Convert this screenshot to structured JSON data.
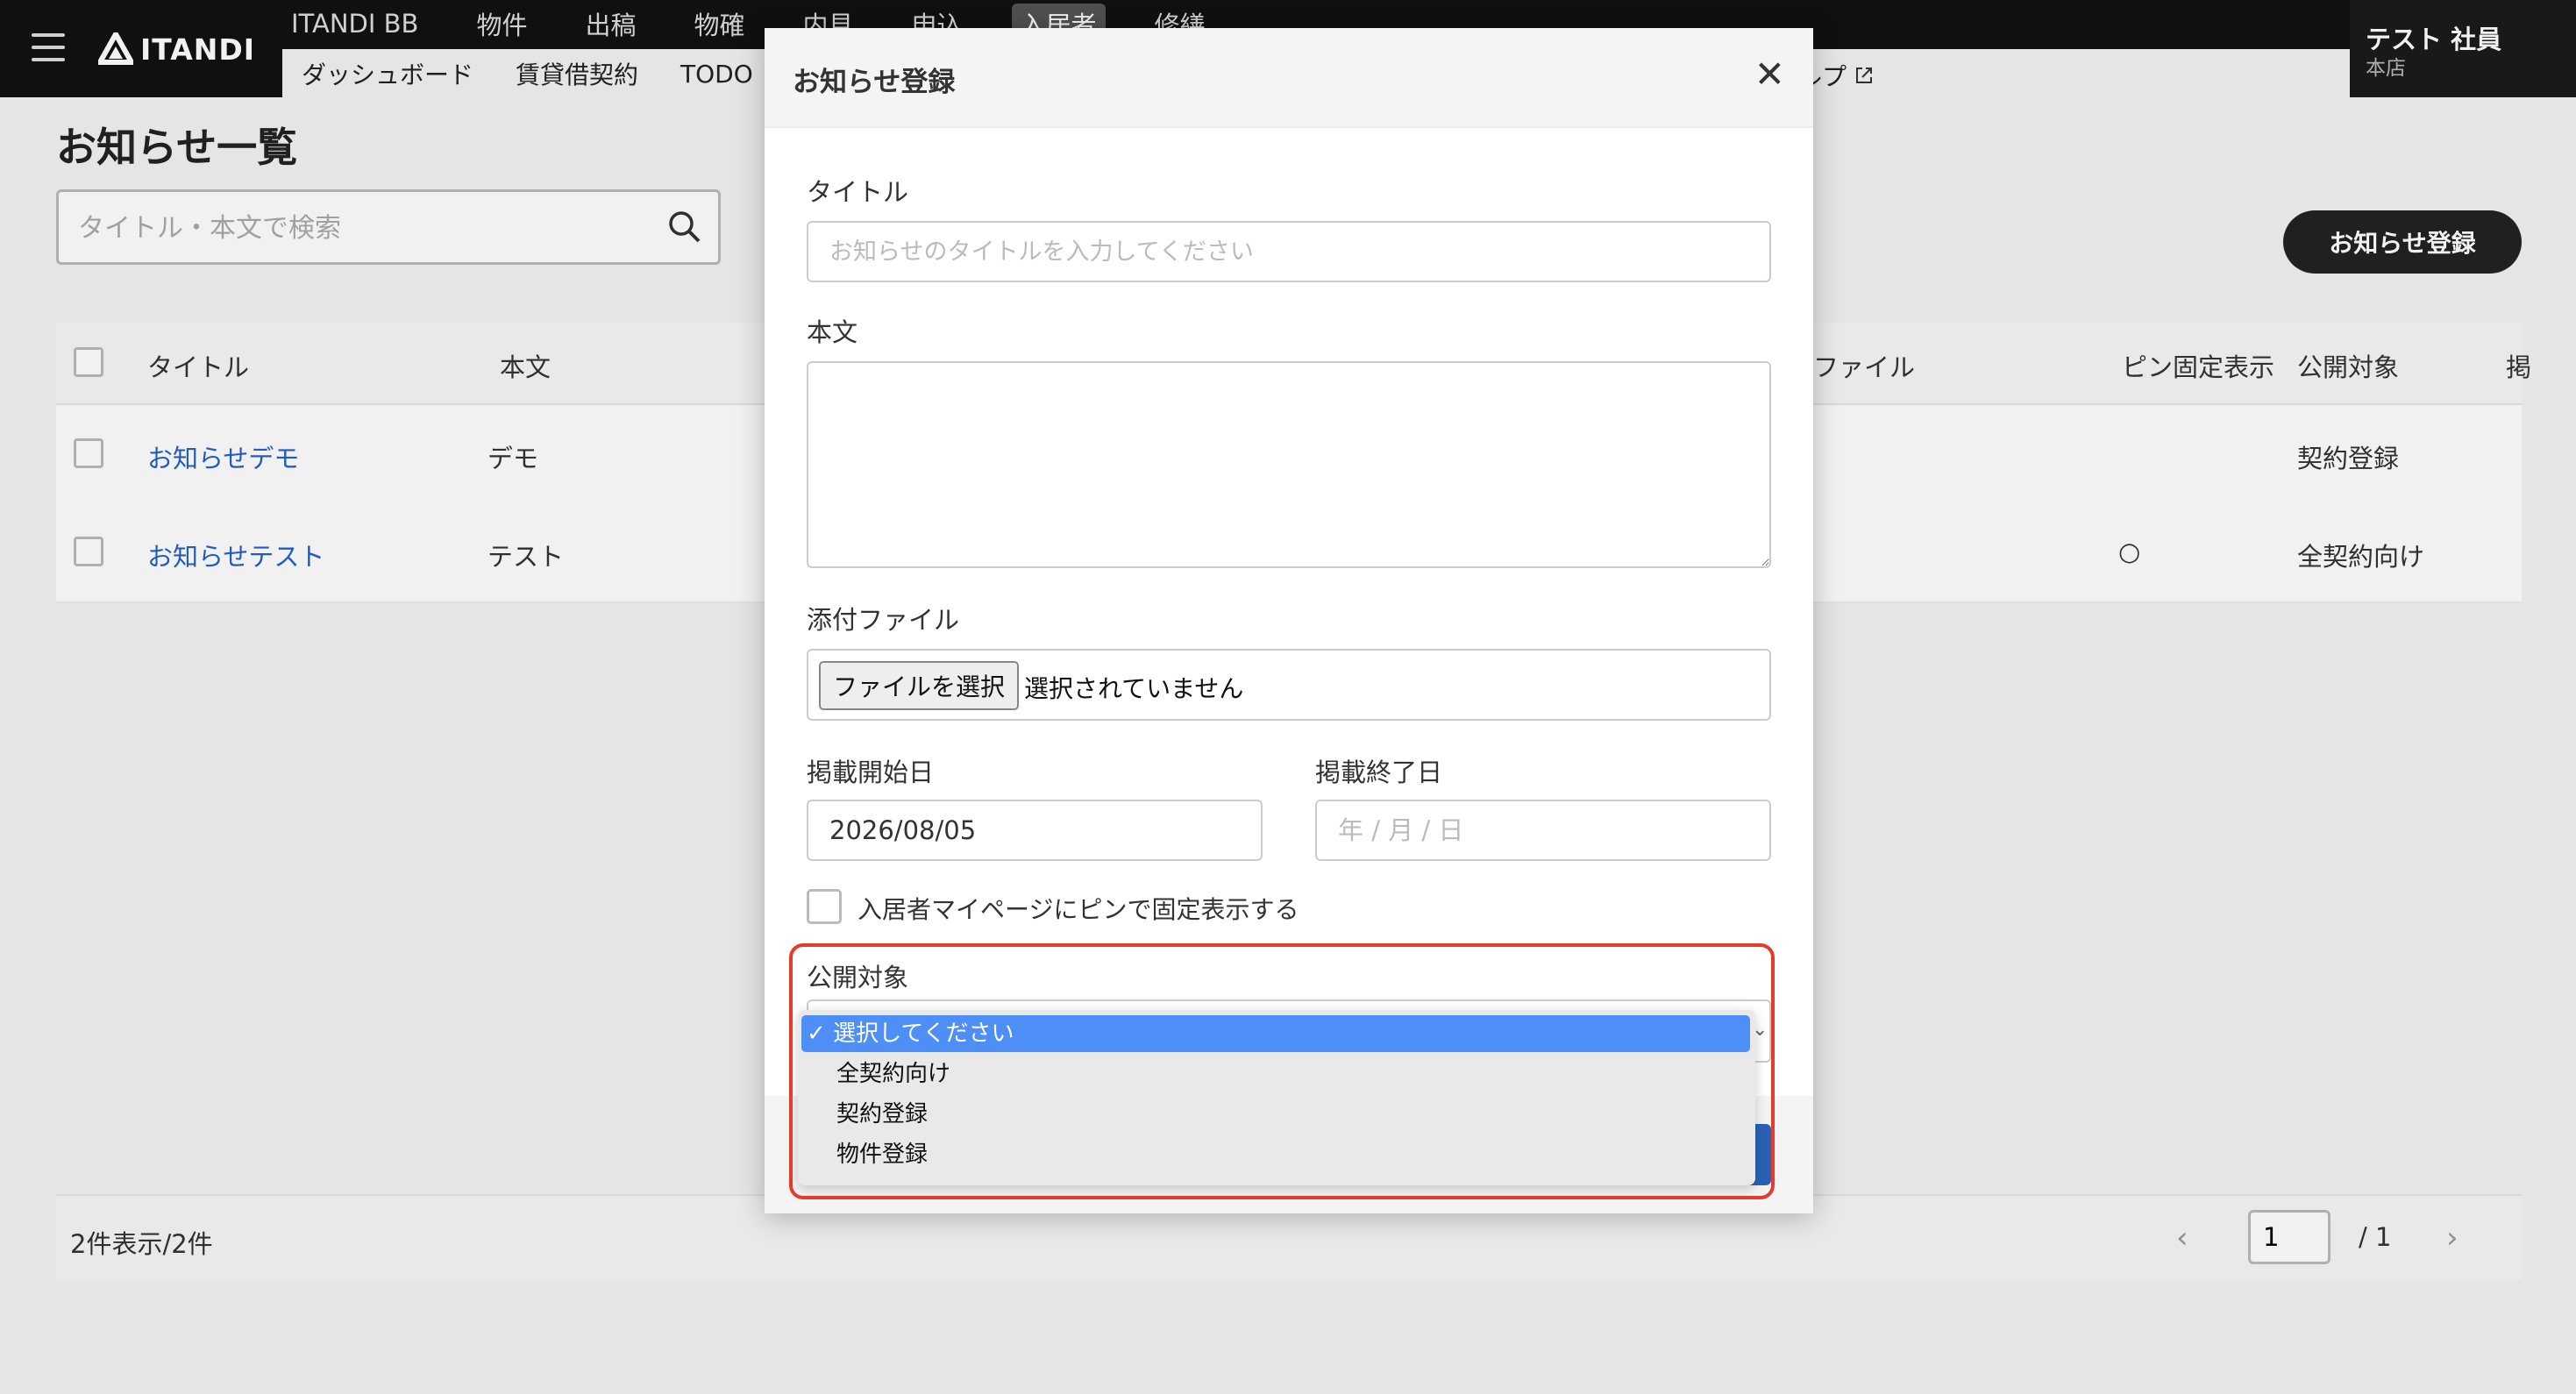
{
  "header": {
    "brand": "ITANDI",
    "nav_main": [
      "ITANDI BB",
      "物件",
      "出稿",
      "物確",
      "内見",
      "申込",
      "入居者",
      "修繕"
    ],
    "nav_main_active": 6,
    "nav_sub": [
      "ダッシュボード",
      "賃貸借契約",
      "TODO"
    ],
    "nav_sub_help": "ルプ",
    "user_name": "テスト 社員",
    "user_branch": "本店"
  },
  "page": {
    "title": "お知らせ一覧",
    "search_placeholder": "タイトル・本文で検索",
    "register_button": "お知らせ登録",
    "columns": [
      "タイトル",
      "本文",
      "ファイル",
      "ピン固定表示",
      "公開対象",
      "掲"
    ],
    "rows": [
      {
        "title": "お知らせデモ",
        "body": "デモ",
        "pin": "",
        "target": "契約登録"
      },
      {
        "title": "お知らせテスト",
        "body": "テスト",
        "pin": "○",
        "target": "全契約向け"
      }
    ],
    "count_text": "2件表示/2件",
    "pager": {
      "prev": "‹",
      "current": "1",
      "total": "/ 1",
      "next": "›"
    }
  },
  "modal": {
    "title": "お知らせ登録",
    "close": "✕",
    "title_label": "タイトル",
    "title_placeholder": "お知らせのタイトルを入力してください",
    "body_label": "本文",
    "file_label": "添付ファイル",
    "file_button": "ファイルを選択",
    "file_status": "選択されていません",
    "start_label": "掲載開始日",
    "start_value": "2026/08/05",
    "end_label": "掲載終了日",
    "end_placeholder": "年 / 月 / 日",
    "pin_label": "入居者マイページにピンで固定表示する",
    "target_label": "公開対象",
    "target_options": [
      "選択してください",
      "全契約向け",
      "契約登録",
      "物件登録"
    ],
    "target_selected_index": 0,
    "check_mark": "✓"
  },
  "colors": {
    "header_bg": "#111111",
    "link": "#2563c9",
    "highlight": "#e43b2c",
    "option_selected": "#4e8ef7"
  }
}
